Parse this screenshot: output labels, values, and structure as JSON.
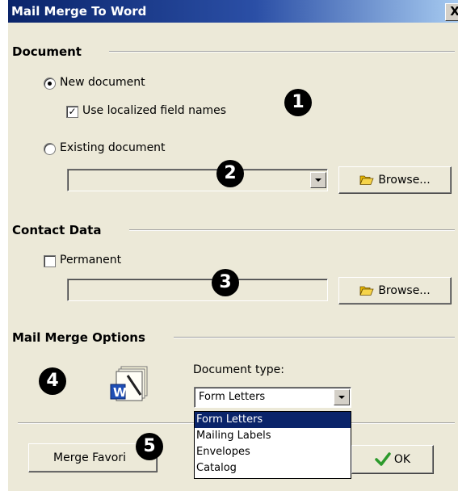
{
  "window": {
    "title": "Mail Merge To Word",
    "close_label": "X"
  },
  "document_group": {
    "title": "Document",
    "new_document_label": "New document",
    "localized_fields_label": "Use localized field names",
    "existing_document_label": "Existing document",
    "existing_path_value": "",
    "browse_label": "Browse..."
  },
  "contact_group": {
    "title": "Contact Data",
    "permanent_label": "Permanent",
    "path_value": "",
    "browse_label": "Browse..."
  },
  "options_group": {
    "title": "Mail Merge Options",
    "document_type_label": "Document type:",
    "document_type_value": "Form Letters",
    "document_type_options": [
      "Form Letters",
      "Mailing Labels",
      "Envelopes",
      "Catalog"
    ]
  },
  "footer": {
    "merge_favorites_label": "Merge Favori",
    "ok_label": "OK"
  },
  "markers": [
    "1",
    "2",
    "3",
    "4",
    "5"
  ],
  "icons": {
    "folder": "folder-open-icon",
    "word": "word-document-icon",
    "ok": "checkmark-icon"
  },
  "colors": {
    "title_bar": "#0a246a",
    "dialog_bg": "#ece9d8",
    "selection": "#0a246a",
    "ok_check": "#2c9a2c"
  }
}
